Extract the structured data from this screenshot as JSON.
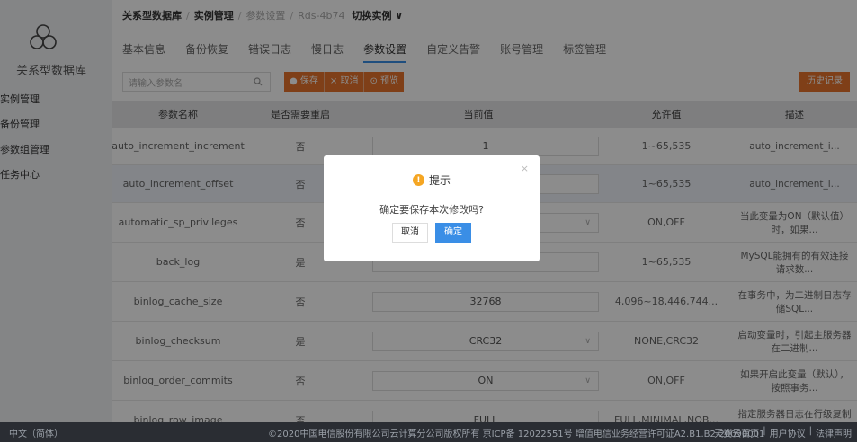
{
  "sidebar": {
    "brand": "关系型数据库",
    "items": [
      {
        "label": "实例管理"
      },
      {
        "label": "备份管理"
      },
      {
        "label": "参数组管理"
      },
      {
        "label": "任务中心"
      }
    ]
  },
  "breadcrumb": {
    "root": "关系型数据库",
    "section": "实例管理",
    "page": "参数设置",
    "instance": "Rds-4b74",
    "switch": "切换实例 ∨"
  },
  "tabs": [
    "基本信息",
    "备份恢复",
    "错误日志",
    "慢日志",
    "参数设置",
    "自定义告警",
    "账号管理",
    "标签管理"
  ],
  "active_tab_index": 4,
  "toolbar": {
    "search_placeholder": "请输入参数名",
    "save_label": "● 保存",
    "cancel_label": "× 取消",
    "preview_label": "⊙ 预览",
    "history_label": "历史记录",
    "accent_color": "#e7742c"
  },
  "table": {
    "headers": [
      "参数名称",
      "是否需要重启",
      "当前值",
      "允许值",
      "描述"
    ],
    "rows": [
      {
        "name": "auto_increment_increment",
        "restart": "否",
        "value": "1",
        "allowed": "1~65,535",
        "desc": "auto_increment_i..."
      },
      {
        "name": "auto_increment_offset",
        "restart": "否",
        "value": "",
        "allowed": "1~65,535",
        "desc": "auto_increment_i..."
      },
      {
        "name": "automatic_sp_privileges",
        "restart": "否",
        "value": "",
        "allowed": "ON,OFF",
        "desc": "当此变量为ON（默认值）时，如果..."
      },
      {
        "name": "back_log",
        "restart": "是",
        "value": "",
        "allowed": "1~65,535",
        "desc": "MySQL能拥有的有效连接请求数..."
      },
      {
        "name": "binlog_cache_size",
        "restart": "否",
        "value": "32768",
        "allowed": "4,096~18,446,744...",
        "desc": "在事务中，为二进制日志存储SQL..."
      },
      {
        "name": "binlog_checksum",
        "restart": "是",
        "value": "CRC32",
        "allowed": "NONE,CRC32",
        "desc": "启动变量时，引起主服务器在二进制..."
      },
      {
        "name": "binlog_order_commits",
        "restart": "否",
        "value": "ON",
        "allowed": "ON,OFF",
        "desc": "如果开启此变量（默认），按照事务..."
      },
      {
        "name": "binlog_row_image",
        "restart": "否",
        "value": "FULL",
        "allowed": "FULL,MINIMAL,NOB...",
        "desc": "指定服务器日志在行级复制时对"
      }
    ]
  },
  "dialog": {
    "title": "提示",
    "message": "确定要保存本次修改吗?",
    "cancel": "取消",
    "confirm": "确定",
    "close": "×"
  },
  "footer": {
    "language": "中文（简体）",
    "copyright": "©2020中国电信股份有限公司云计算分公司版权所有 京ICP备 12022551号 增值电信业务经营许可证A2.B1.B2-20090001",
    "links": [
      "天翼云首页",
      "|",
      "用户协议",
      "|",
      "法律声明"
    ]
  }
}
